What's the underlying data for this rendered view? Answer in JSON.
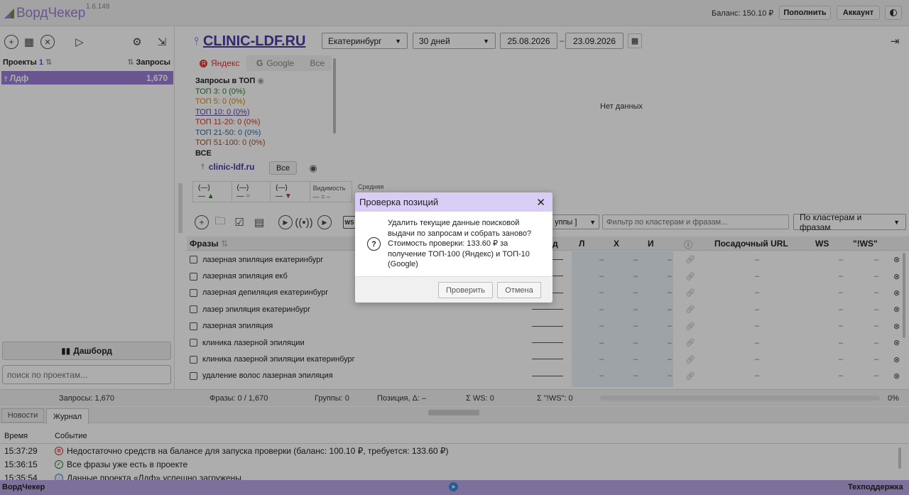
{
  "app": {
    "name": "ВордЧекер",
    "version": "1.6.149"
  },
  "header": {
    "balance": "Баланс: 150.10 ₽",
    "topup_label": "Пополнить",
    "account_label": "Аккаунт"
  },
  "sidebar": {
    "projects_label": "Проекты",
    "projects_count": "1",
    "queries_label": "Запросы",
    "projects": [
      {
        "name": "Лдф",
        "count": "1,670"
      }
    ],
    "dashboard_label": "Дашборд",
    "search_placeholder": "поиск по проектам..."
  },
  "toolbar": {
    "site": "CLINIC-LDF.RU",
    "region": "Екатеринбург",
    "period": "30 дней",
    "date_from": "25.08.2026",
    "date_sep": "–",
    "date_to": "23.09.2026"
  },
  "engines": {
    "tabs": [
      "Яндекс",
      "Google",
      "Все"
    ]
  },
  "top_stats": {
    "title": "Запросы в ТОП",
    "items": [
      {
        "label": "ТОП 3: 0 (0%)",
        "color": "#2e7d32"
      },
      {
        "label": "ТОП 5: 0 (0%)",
        "color": "#d68a1a"
      },
      {
        "label": "ТОП 10: 0 (0%)",
        "color": "#5b4a9a"
      },
      {
        "label": "ТОП 11-20: 0 (0%)",
        "color": "#c0392b"
      },
      {
        "label": "ТОП 21-50: 0 (0%)",
        "color": "#2a6aa8"
      },
      {
        "label": "ТОП 51-100: 0 (0%)",
        "color": "#a0522d"
      },
      {
        "label": "ВСЕ",
        "color": "#222222"
      }
    ]
  },
  "chart": {
    "empty_label": "Нет данных"
  },
  "domain_row": {
    "domain": "clinic-ldf.ru",
    "all_label": "Все"
  },
  "mini_stats": {
    "cells": [
      "(—)",
      "(—)",
      "(—)"
    ],
    "visibility_label": "Видимость",
    "average_label": "Средняя"
  },
  "filters": {
    "groups_partial": "уппы ]",
    "cluster_placeholder": "Фильтр по кластерам и фразам...",
    "cluster_mode": "По кластерам и фразам"
  },
  "table": {
    "columns": {
      "phrases": "Фразы",
      "d": "д",
      "l": "Л",
      "x": "Х",
      "i": "И",
      "url": "Посадочный URL",
      "ws": "WS",
      "iws": "\"!WS\""
    },
    "rows": [
      "лазерная эпиляция екатеринбург",
      "лазерная эпиляция екб",
      "лазерная депиляция екатеринбург",
      "лазер эпиляция екатеринбург",
      "лазерная эпиляция",
      "клиника лазерной эпиляции",
      "клиника лазерной эпиляции екатеринбург",
      "удаление волос лазерная эпиляция"
    ],
    "empty": "–"
  },
  "statusbar": {
    "queries": "Запросы: 1,670",
    "phrases": "Фразы: 0 / 1,670",
    "groups": "Группы: 0",
    "position": "Позиция, Δ: –",
    "ws": "Σ WS: 0",
    "iws": "Σ \"!WS\": 0",
    "progress_value": 0,
    "progress": "0%"
  },
  "bottom": {
    "tabs": [
      "Новости",
      "Журнал"
    ],
    "col_time": "Время",
    "col_event": "Событие",
    "log": [
      {
        "time": "15:37:29",
        "type": "error",
        "text": "Недостаточно средств на балансе для запуска проверки (баланс: 100.10 ₽, требуется: 133.60 ₽)"
      },
      {
        "time": "15:36:15",
        "type": "ok",
        "text": "Все фразы уже есть в проекте"
      },
      {
        "time": "15:35:54",
        "type": "info",
        "text": "Данные проекта «Лдф» успешно загружены"
      }
    ]
  },
  "footer": {
    "left": "ВордЧекер",
    "right": "Техподдержка"
  },
  "dialog": {
    "title": "Проверка позиций",
    "message_1": "Удалить текущие данные поисковой выдачи по запросам и собрать заново?",
    "message_2": "Стоимость проверки: 133.60 ₽ за получение ТОП-100 (Яндекс) и ТОП-10 (Google)",
    "confirm_label": "Проверить",
    "cancel_label": "Отмена"
  },
  "colors": {
    "accent": "#9b7fd4",
    "accent_light": "#d9ccf5",
    "footer": "#b9a6e3"
  }
}
